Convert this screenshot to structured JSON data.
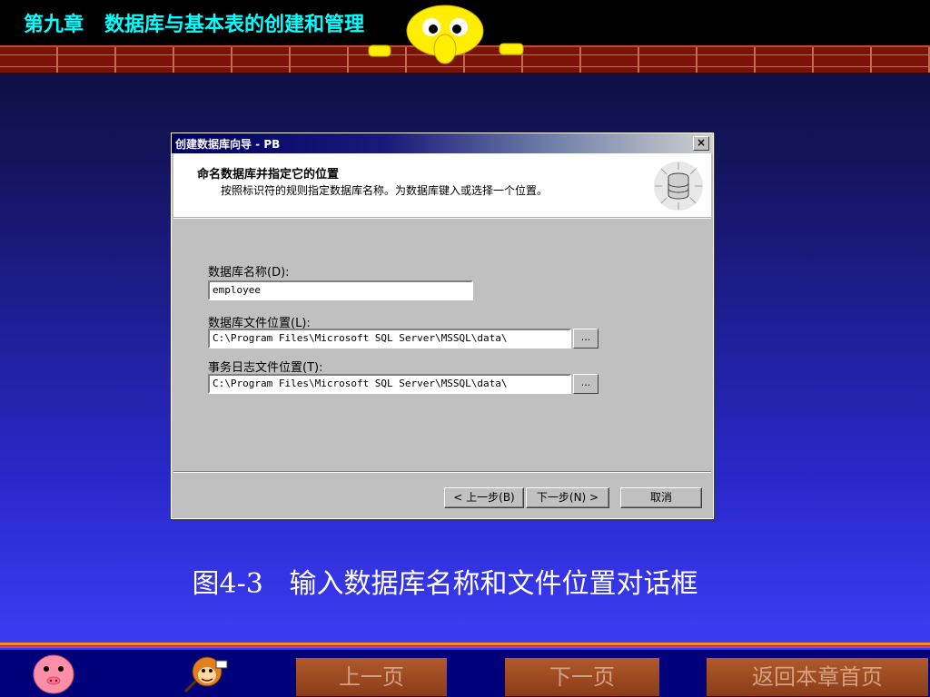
{
  "header": {
    "chapter_title": "第九章   数据库与基本表的创建和管理"
  },
  "dialog": {
    "title": "创建数据库向导 - PB",
    "close_label": "×",
    "heading": "命名数据库并指定它的位置",
    "description": "按照标识符的规则指定数据库名称。为数据库键入或选择一个位置。",
    "fields": {
      "db_name_label": "数据库名称(D):",
      "db_name_value": "employee",
      "db_file_label": "数据库文件位置(L):",
      "db_file_value": "C:\\Program Files\\Microsoft SQL Server\\MSSQL\\data\\",
      "log_file_label": "事务日志文件位置(T):",
      "log_file_value": "C:\\Program Files\\Microsoft SQL Server\\MSSQL\\data\\",
      "browse_label": "..."
    },
    "buttons": {
      "back": "< 上一步(B)",
      "next": "下一步(N) >",
      "cancel": "取消"
    }
  },
  "caption": "图4-3   输入数据库名称和文件位置对话框",
  "nav": {
    "prev": "上一页",
    "next": "下一页",
    "return": "返回本章首页"
  },
  "colors": {
    "chapter_title": "#00ffff",
    "title_bar": "#000060",
    "nav_button": "#9a4a20"
  }
}
